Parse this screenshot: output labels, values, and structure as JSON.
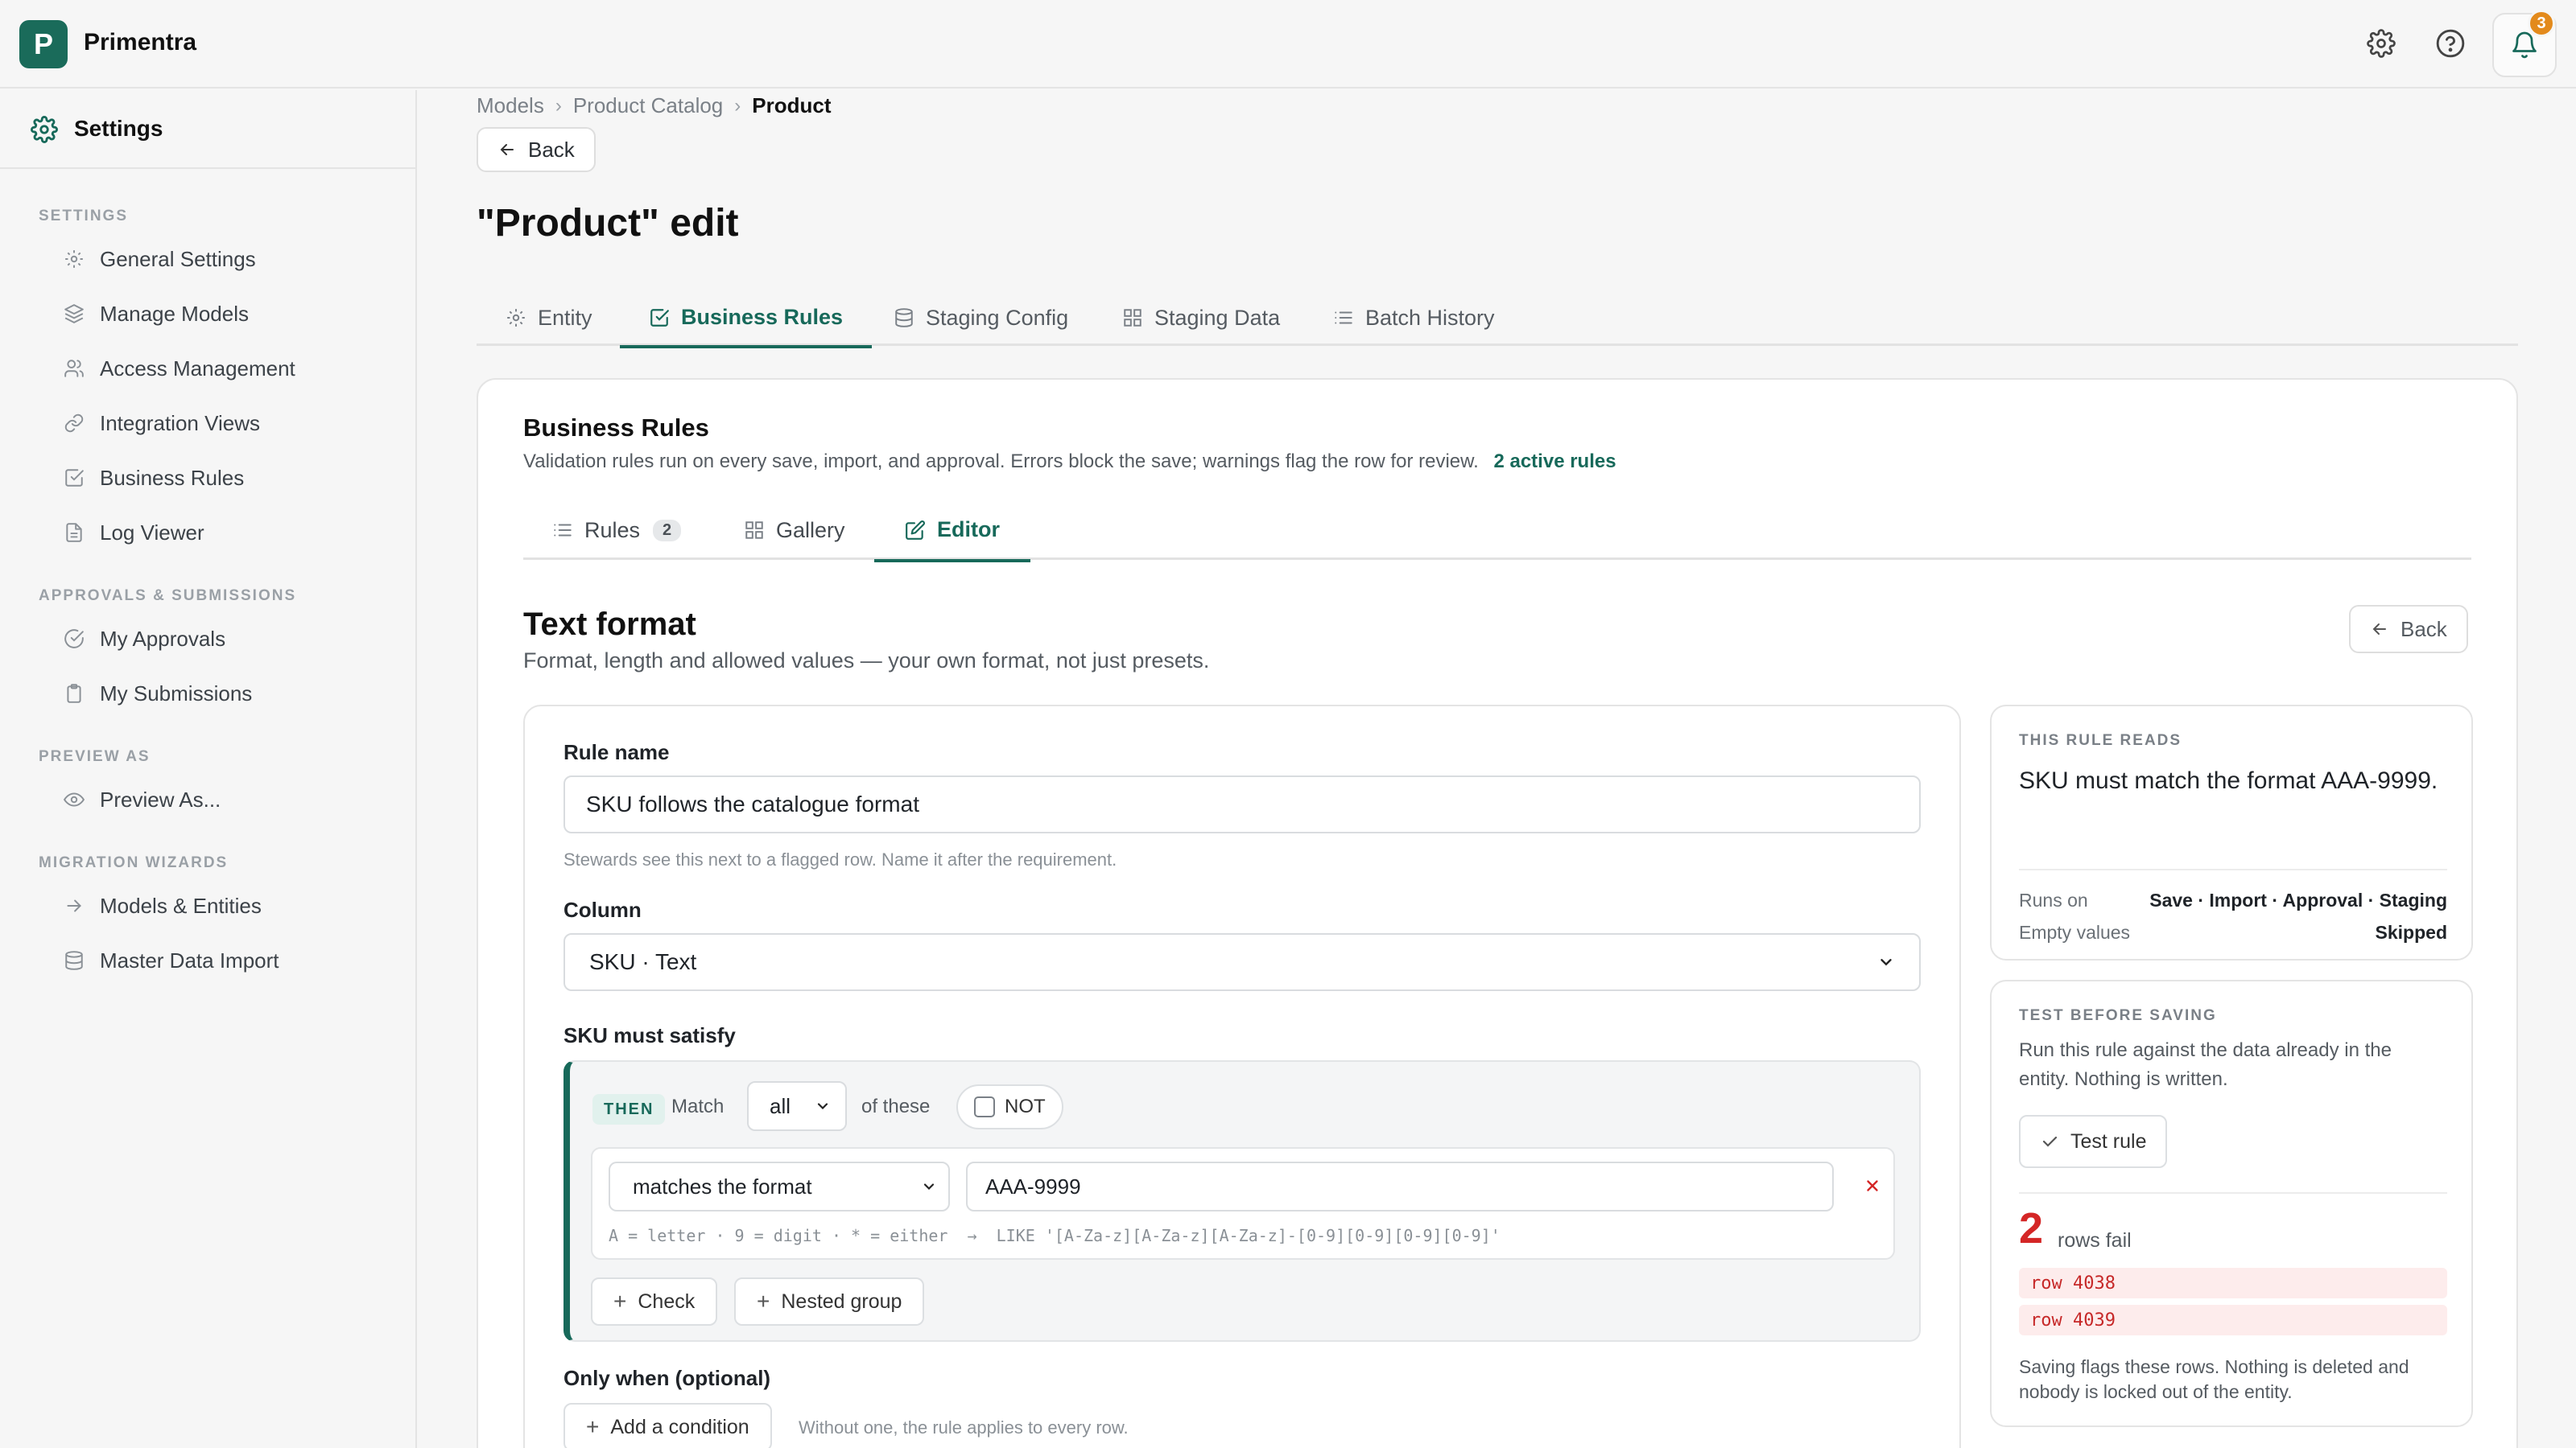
{
  "app": {
    "brand": "Primentra",
    "logo_letter": "P",
    "notifications_count": "3"
  },
  "sidebar": {
    "header": "Settings",
    "sections": [
      {
        "title": "SETTINGS",
        "items": [
          {
            "label": "General Settings",
            "icon": "gear-icon"
          },
          {
            "label": "Manage Models",
            "icon": "layers-icon"
          },
          {
            "label": "Access Management",
            "icon": "users-icon"
          },
          {
            "label": "Integration Views",
            "icon": "link-icon"
          },
          {
            "label": "Business Rules",
            "icon": "check-square-icon"
          },
          {
            "label": "Log Viewer",
            "icon": "file-icon"
          }
        ]
      },
      {
        "title": "APPROVALS & SUBMISSIONS",
        "items": [
          {
            "label": "My Approvals",
            "icon": "check-circle-icon"
          },
          {
            "label": "My Submissions",
            "icon": "clipboard-icon"
          }
        ]
      },
      {
        "title": "PREVIEW AS",
        "items": [
          {
            "label": "Preview As...",
            "icon": "eye-icon"
          }
        ]
      },
      {
        "title": "MIGRATION WIZARDS",
        "items": [
          {
            "label": "Models & Entities",
            "icon": "arrow-right-icon"
          },
          {
            "label": "Master Data Import",
            "icon": "database-icon"
          }
        ]
      }
    ]
  },
  "breadcrumb": [
    "Models",
    "Product Catalog",
    "Product"
  ],
  "back_label": "Back",
  "page_title": "\"Product\" edit",
  "main_tabs": [
    {
      "label": "Entity",
      "icon": "gear-icon"
    },
    {
      "label": "Business Rules",
      "icon": "check-square-icon",
      "active": true
    },
    {
      "label": "Staging Config",
      "icon": "database-icon"
    },
    {
      "label": "Staging Data",
      "icon": "grid-icon"
    },
    {
      "label": "Batch History",
      "icon": "list-icon"
    }
  ],
  "card": {
    "title": "Business Rules",
    "subtitle": "Validation rules run on every save, import, and approval. Errors block the save; warnings flag the row for review.",
    "active_rules": "2 active rules",
    "sub_tabs": [
      {
        "label": "Rules",
        "count": "2",
        "icon": "list-icon"
      },
      {
        "label": "Gallery",
        "icon": "grid-icon"
      },
      {
        "label": "Editor",
        "icon": "edit-icon",
        "active": true
      }
    ]
  },
  "editor": {
    "title": "Text format",
    "subtitle": "Format, length and allowed values — your own format, not just presets.",
    "back_label": "Back",
    "rule_name_label": "Rule name",
    "rule_name_value": "SKU follows the catalogue format",
    "rule_name_hint": "Stewards see this next to a flagged row. Name it after the requirement.",
    "column_label": "Column",
    "column_value": "SKU · Text",
    "must_satisfy_label": "SKU must satisfy",
    "group": {
      "then_label": "THEN",
      "match_label": "Match",
      "match_value": "all",
      "of_these_label": "of these",
      "not_label": "NOT",
      "condition": {
        "operator": "matches the format",
        "value": "AAA-9999",
        "hint": "A = letter · 9 = digit · * = either  →  LIKE '[A-Za-z][A-Za-z][A-Za-z]-[0-9][0-9][0-9][0-9]'"
      },
      "check_button": "Check",
      "nested_group_button": "Nested group"
    },
    "only_when_label": "Only when (optional)",
    "add_condition_button": "Add a condition",
    "add_condition_hint": "Without one, the rule applies to every row."
  },
  "rule_reads": {
    "kicker": "THIS RULE READS",
    "text": "SKU must match the format AAA-9999.",
    "runs_on_label": "Runs on",
    "runs_on_value": "Save · Import · Approval · Staging",
    "empty_values_label": "Empty values",
    "empty_values_value": "Skipped"
  },
  "test_panel": {
    "kicker": "TEST BEFORE SAVING",
    "description": "Run this rule against the data already in the entity. Nothing is written.",
    "test_button": "Test rule",
    "fail_count": "2",
    "fail_label": "rows fail",
    "failed_rows": [
      "row 4038",
      "row 4039"
    ],
    "note": "Saving flags these rows. Nothing is deleted and nobody is locked out of the entity."
  },
  "colors": {
    "accent": "#17695a",
    "logo_bg": "#1a6b5a",
    "badge": "#e38a1c",
    "error": "#d42626"
  }
}
